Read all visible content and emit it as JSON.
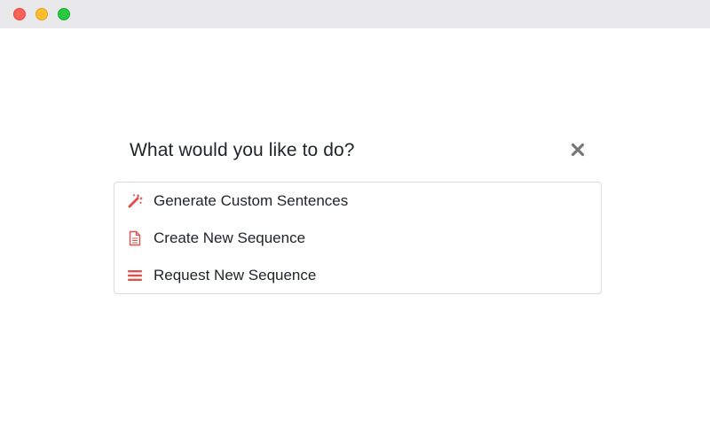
{
  "window": {
    "controls": [
      "close",
      "minimize",
      "zoom"
    ]
  },
  "dialog": {
    "title": "What would you like to do?",
    "close_icon": "close-icon",
    "accent_color": "#d9534f",
    "options": [
      {
        "label": "Generate Custom Sentences",
        "icon": "magic-wand-icon"
      },
      {
        "label": "Create New Sequence",
        "icon": "document-icon"
      },
      {
        "label": "Request New Sequence",
        "icon": "list-icon"
      }
    ]
  }
}
